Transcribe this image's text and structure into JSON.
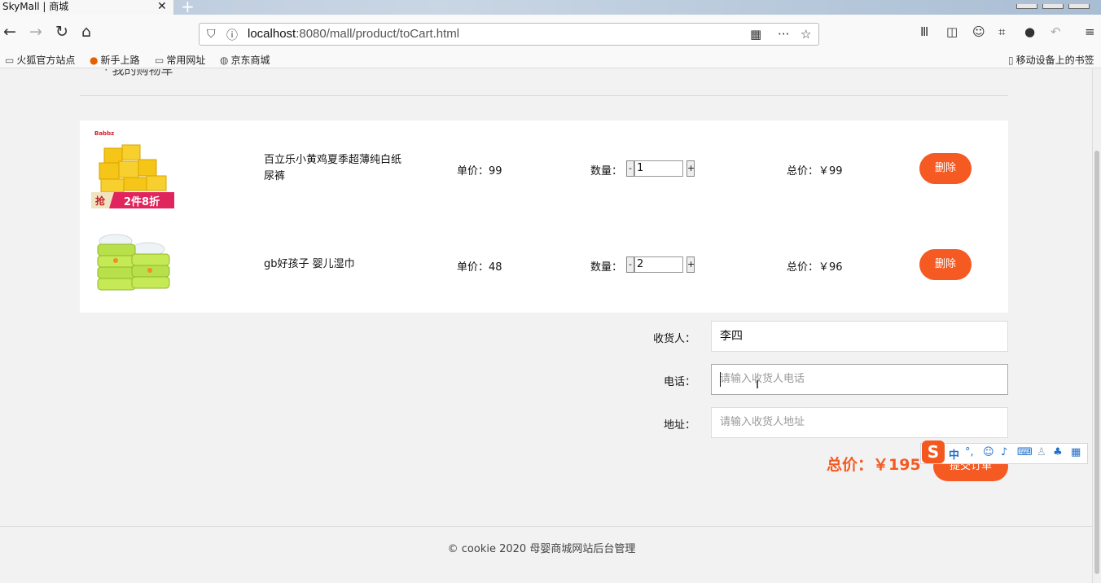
{
  "browser": {
    "tab_title": "SkyMall | 商城",
    "tab_close": "✕",
    "new_tab": "+",
    "url_host": "localhost",
    "url_rest": ":8080/mall/product/toCart.html",
    "bookmarks": [
      "火狐官方站点",
      "新手上路",
      "常用网址",
      "京东商城"
    ],
    "mobile_bookmarks": "移动设备上的书签"
  },
  "cart": {
    "heading_fragment": "· 我的购物车",
    "items": [
      {
        "name": "百立乐小黄鸡夏季超薄纯白纸尿裤",
        "price_label": "单价：99",
        "qty_label": "数量：",
        "minus": "-",
        "plus": "+",
        "quantity": "1",
        "total_label": "总价：￥99",
        "delete_label": "删除",
        "promo_left": "抢",
        "promo_right": "2件8折",
        "brand_tag": "Babbz"
      },
      {
        "name": "gb好孩子 婴儿湿巾",
        "price_label": "单价：48",
        "qty_label": "数量：",
        "minus": "-",
        "plus": "+",
        "quantity": "2",
        "total_label": "总价：￥96",
        "delete_label": "删除"
      }
    ]
  },
  "form": {
    "receiver_label": "收货人：",
    "receiver_value": "李四",
    "phone_label": "电话：",
    "phone_placeholder": "请输入收货人电话",
    "address_label": "地址：",
    "address_placeholder": "请输入收货人地址"
  },
  "summary": {
    "grand_total": "总价：￥195",
    "submit_label": "提交订单"
  },
  "ime": {
    "logo": "S",
    "mode": "中"
  },
  "footer": {
    "text": "© cookie 2020   母婴商城网站后台管理"
  }
}
